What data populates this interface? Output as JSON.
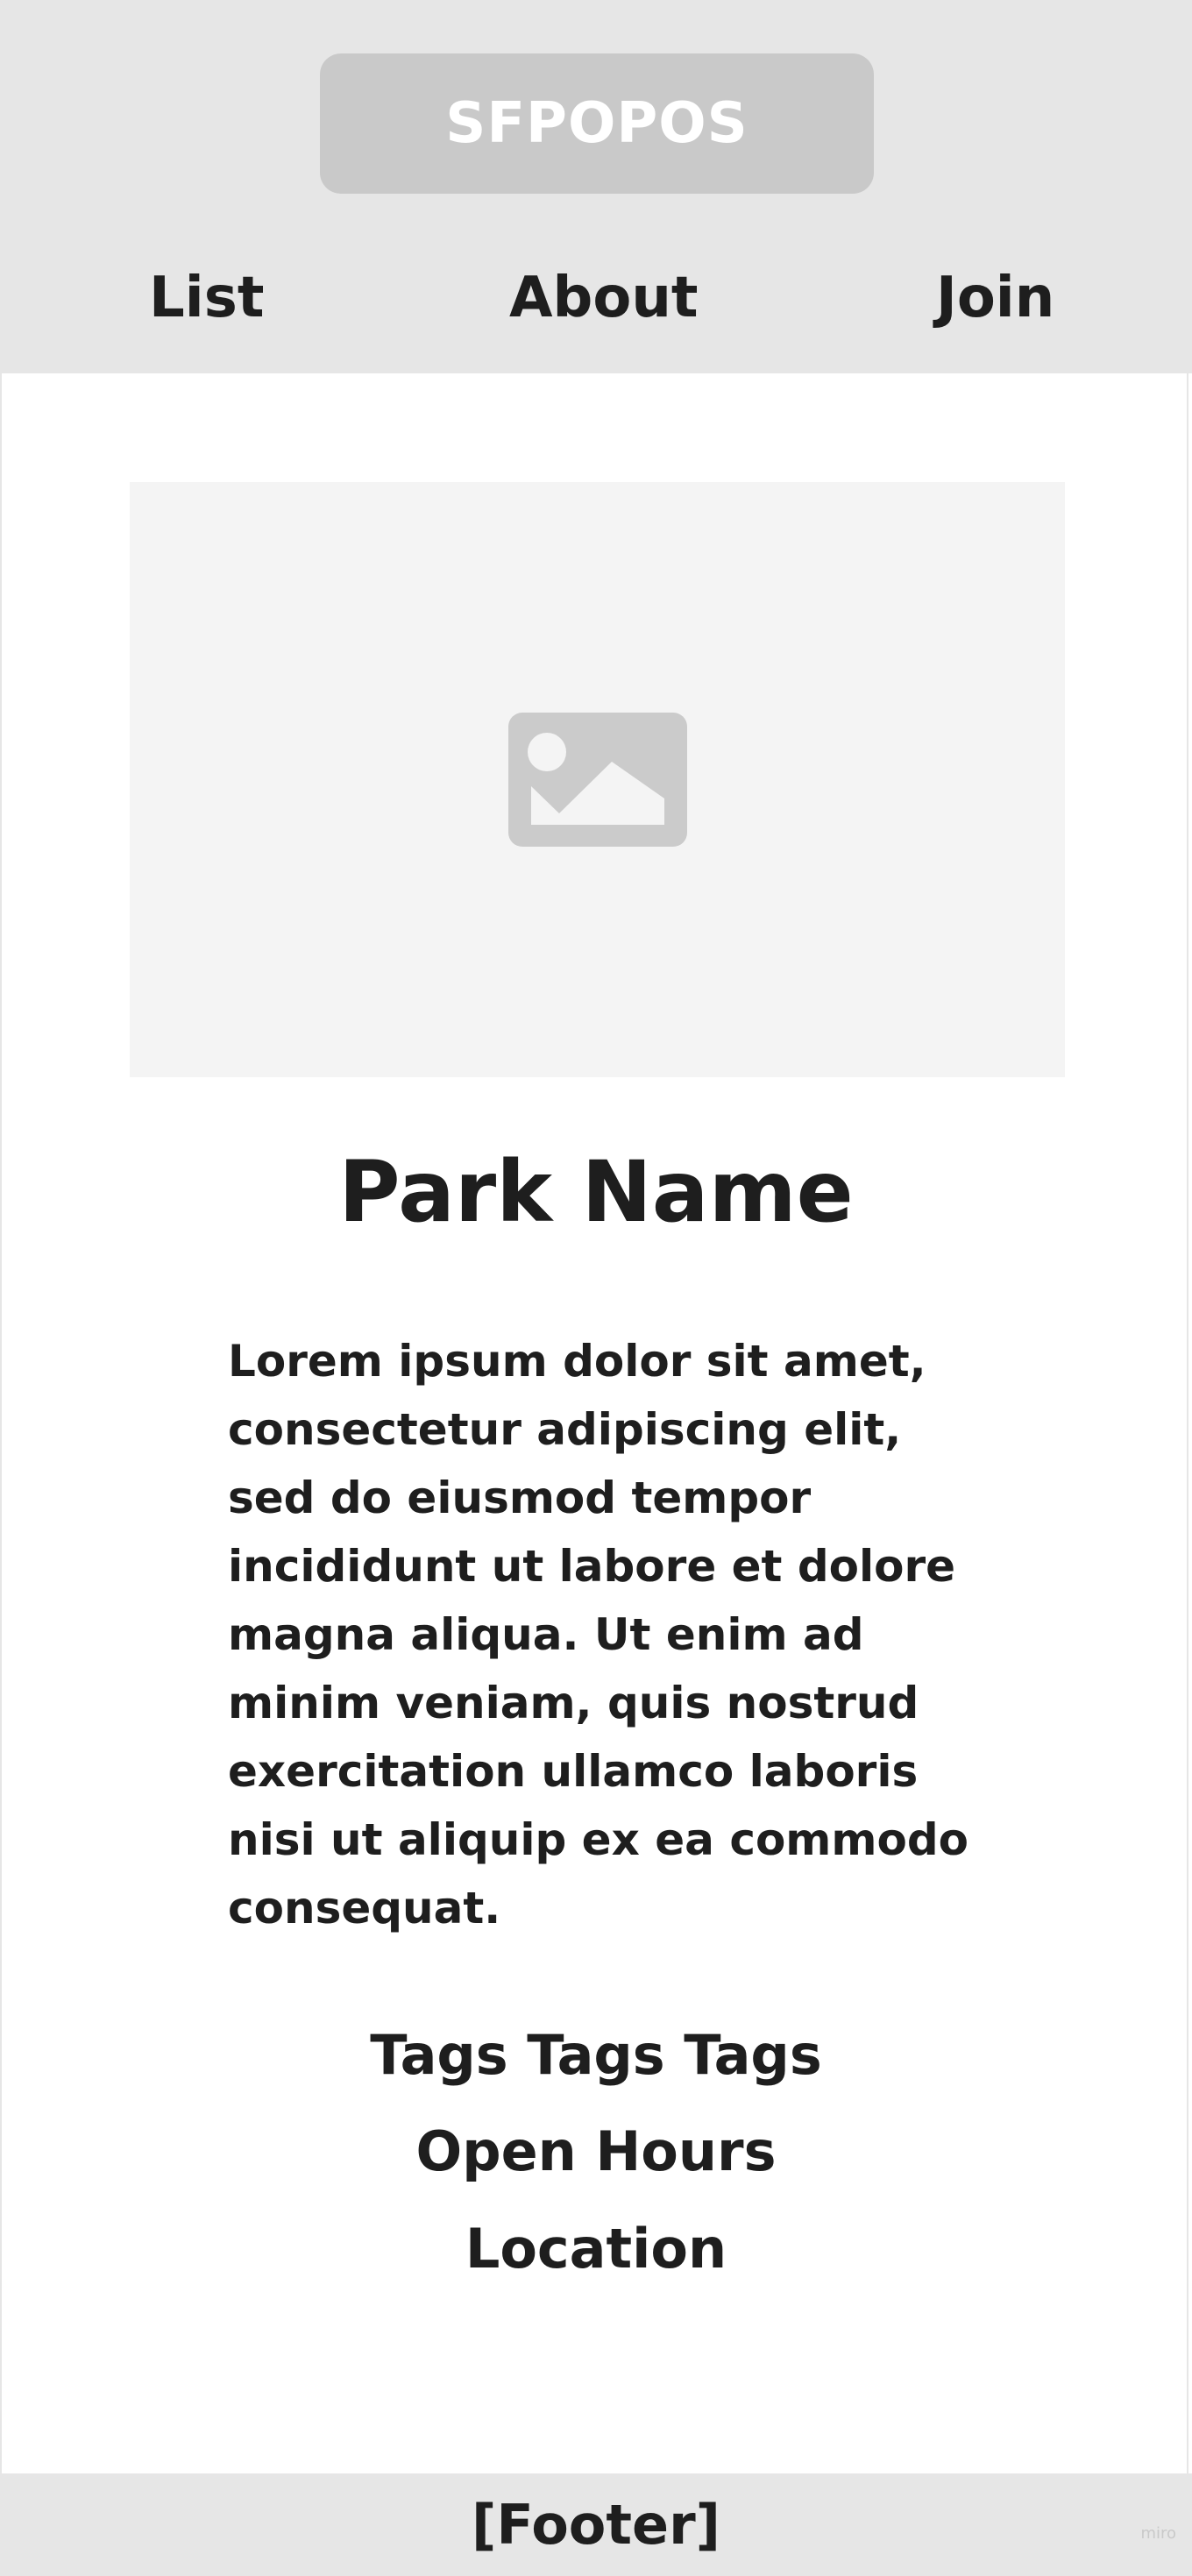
{
  "header": {
    "logo_label": "SFPOPOS",
    "nav": [
      {
        "label": "List"
      },
      {
        "label": "About"
      },
      {
        "label": "Join"
      }
    ]
  },
  "main": {
    "image_icon": "image-placeholder-icon",
    "park_name": "Park Name",
    "description": "Lorem ipsum dolor sit amet, consectetur adipiscing elit, sed do eiusmod tempor incididunt ut labore et dolore magna aliqua. Ut enim ad minim veniam, quis nostrud exercitation ullamco laboris nisi ut aliquip ex ea commodo consequat.",
    "tags": "Tags Tags Tags",
    "open_hours": "Open Hours",
    "location": "Location"
  },
  "footer": {
    "label": "[Footer]"
  },
  "watermark": "miro",
  "colors": {
    "header_bg": "#e6e6e6",
    "logo_bg": "#c9c9c9",
    "image_bg": "#f4f4f4",
    "text": "#1e1e1e"
  }
}
